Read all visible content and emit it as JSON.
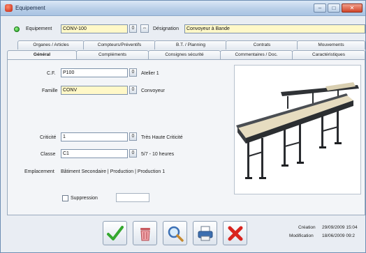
{
  "window": {
    "title": "Equipement"
  },
  "header": {
    "equipement_label": "Equipement",
    "equipement_value": "CONV-100",
    "designation_label": "Désignation",
    "designation_value": "Convoyeur à Bande",
    "picker_glyph": "0",
    "link_glyph": "⇔"
  },
  "tabs_top": [
    "Organes / Articles",
    "Compteurs/Préventifs",
    "B.T. / Planning",
    "Contrats",
    "Mouvements"
  ],
  "tabs_bottom": [
    "Général",
    "Compléments",
    "Consignes sécurité",
    "Commentaires / Doc.",
    "Caractéristiques"
  ],
  "general": {
    "cf_label": "C.F.",
    "cf_value": "P100",
    "cf_desc": "Atelier 1",
    "famille_label": "Famille",
    "famille_value": "CONV",
    "famille_desc": "Convoyeur",
    "criticite_label": "Criticité",
    "criticite_value": "1",
    "criticite_desc": "Très Haute Criticité",
    "classe_label": "Classe",
    "classe_value": "C1",
    "classe_desc": "5/7 - 10 heures",
    "emplacement_label": "Emplacement",
    "emplacement_value": "Bâtiment Secondaire | Production | Production 1",
    "suppression_label": "Suppression",
    "suppression_checked": false
  },
  "toolbar": {
    "validate": "check-icon",
    "delete": "trash-icon",
    "search": "magnifier-icon",
    "print": "printer-icon",
    "cancel": "cross-icon"
  },
  "footer": {
    "creation_label": "Création",
    "creation_value": "29/09/2009  15:04",
    "modification_label": "Modification",
    "modification_value": "18/06/2009  09:2"
  },
  "colors": {
    "field_yellow": "#fff8c8",
    "status_green": "#1a9b1a",
    "cancel_red": "#d9241e",
    "validate_green": "#35a82f"
  }
}
